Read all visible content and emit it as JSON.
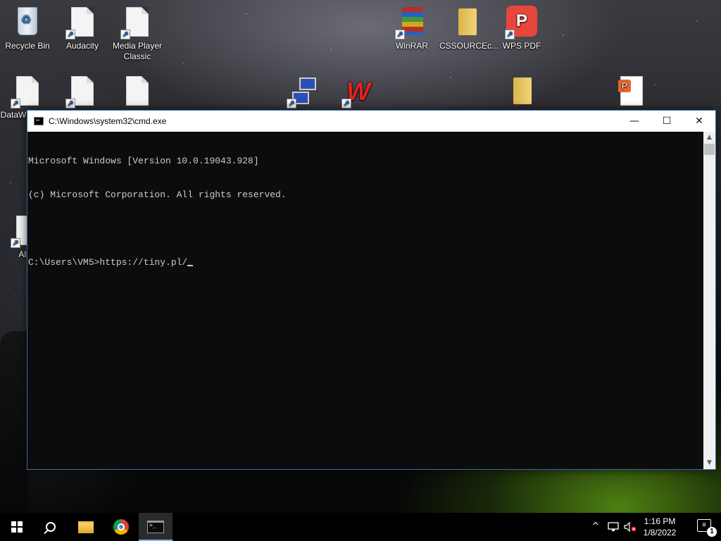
{
  "desktop": {
    "icons": [
      {
        "label": "Recycle Bin",
        "icon": "recycle-bin-icon"
      },
      {
        "label": "Audacity",
        "icon": "document-shortcut-icon"
      },
      {
        "label": "Media Player Classic",
        "icon": "document-shortcut-icon"
      },
      {
        "label": "WinRAR",
        "icon": "winrar-icon"
      },
      {
        "label": "CSSOURCEc...",
        "icon": "folder-icon"
      },
      {
        "label": "WPS PDF",
        "icon": "wps-pdf-icon"
      },
      {
        "label": "DataW",
        "icon": "document-shortcut-icon"
      },
      {
        "label": "All",
        "icon": "document-shortcut-icon"
      }
    ]
  },
  "cmd_window": {
    "title": "C:\\Windows\\system32\\cmd.exe",
    "lines": [
      "Microsoft Windows [Version 10.0.19043.928]",
      "(c) Microsoft Corporation. All rights reserved.",
      "",
      "C:\\Users\\VM5>https://tiny.pl/"
    ],
    "controls": {
      "minimize": "—",
      "maximize": "☐",
      "close": "✕"
    }
  },
  "taskbar": {
    "apps": [
      {
        "name": "start",
        "icon": "windows-logo-icon"
      },
      {
        "name": "search",
        "icon": "search-icon"
      },
      {
        "name": "file-explorer",
        "icon": "file-explorer-icon"
      },
      {
        "name": "chrome",
        "icon": "chrome-icon"
      },
      {
        "name": "command-prompt",
        "icon": "cmd-icon",
        "active": true
      }
    ],
    "tray": {
      "chevron": "^",
      "network_icon": "network-icon",
      "volume_icon": "volume-muted-icon",
      "time": "1:16 PM",
      "date": "1/8/2022",
      "notifications": "1"
    }
  },
  "colors": {
    "console_bg": "#0c0c0c",
    "console_text": "#cccccc",
    "taskbar_bg": "#000000",
    "active_indicator": "#7ab4f5"
  }
}
